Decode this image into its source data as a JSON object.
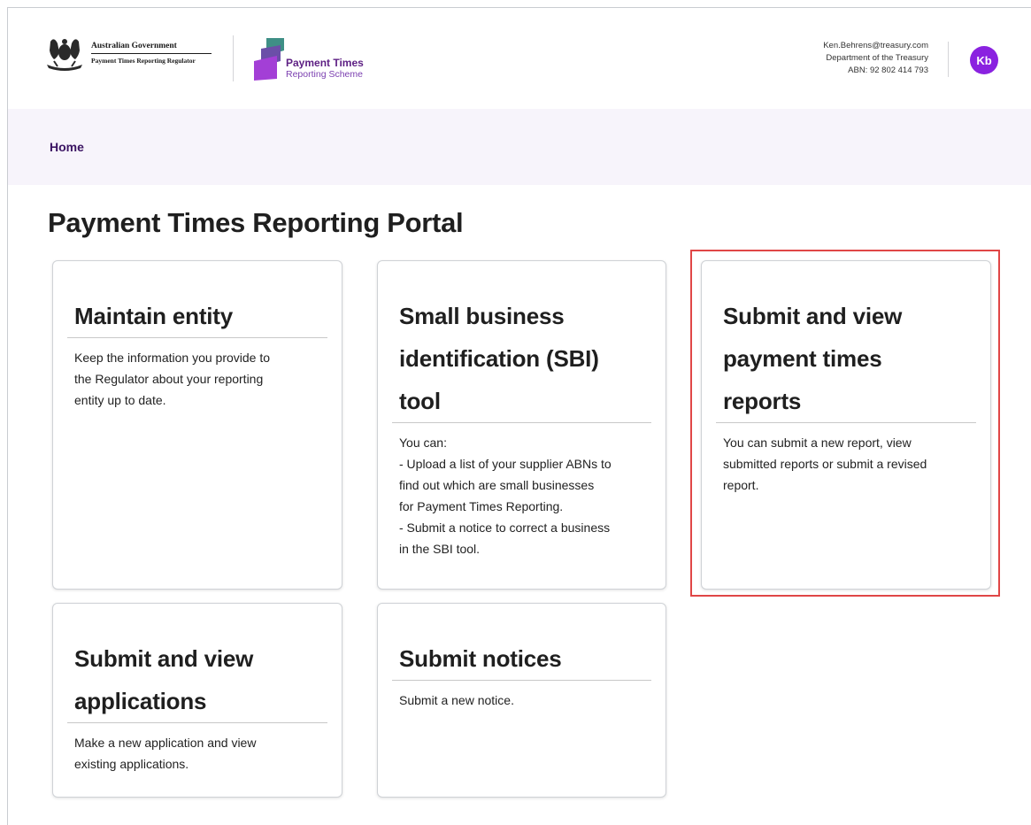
{
  "header": {
    "gov_line1": "Australian Government",
    "gov_line2": "Payment Times Reporting Regulator",
    "scheme_line1": "Payment Times",
    "scheme_line2": "Reporting Scheme",
    "user": {
      "email": "Ken.Behrens@treasury.com",
      "department": "Department of the Treasury",
      "abn": "ABN: 92 802 414 793",
      "initials": "Kb"
    }
  },
  "breadcrumb": {
    "home": "Home"
  },
  "page": {
    "title": "Payment Times Reporting Portal"
  },
  "cards": [
    {
      "title": "Maintain entity",
      "body": [
        "Keep the information you provide to",
        "the Regulator about your reporting",
        "entity up to date."
      ]
    },
    {
      "title_lines": [
        "Small business",
        "identification (SBI)",
        "tool"
      ],
      "body": [
        "You can:",
        "- Upload a list of your supplier ABNs to",
        "find out which are small businesses",
        "for Payment Times Reporting.",
        "- Submit a notice to correct a business",
        "in the SBI tool."
      ]
    },
    {
      "title_lines": [
        "Submit and view",
        "payment times",
        "reports"
      ],
      "body": [
        "You can submit a new report, view",
        "submitted reports or submit a revised",
        "report."
      ]
    },
    {
      "title_lines": [
        "Submit and view",
        "applications"
      ],
      "body": [
        "Make a new application and view",
        "existing applications."
      ]
    },
    {
      "title": "Submit notices",
      "body": [
        "Submit a new notice."
      ]
    }
  ],
  "colors": {
    "accent_purple": "#8a22e0",
    "breadcrumb_bg": "#f7f4fb",
    "highlight_red": "#e04646"
  }
}
